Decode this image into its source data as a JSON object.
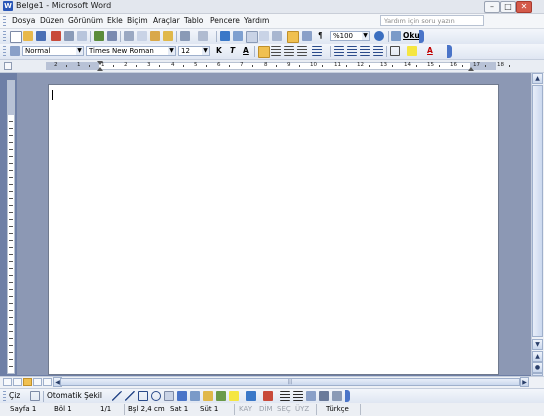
{
  "window": {
    "title": "Belge1 - Microsoft Word",
    "app_icon": "W",
    "minimize": "–",
    "maximize": "□",
    "close": "✕"
  },
  "menu": {
    "items": [
      "Dosya",
      "Düzen",
      "Görünüm",
      "Ekle",
      "Biçim",
      "Araçlar",
      "Tablo",
      "Pencere",
      "Yardım"
    ],
    "help_placeholder": "Yardım için soru yazın"
  },
  "standard_toolbar": {
    "zoom": "%100",
    "read_label": "Oku",
    "pilcrow": "¶"
  },
  "formatting_toolbar": {
    "style": "Normal",
    "font": "Times New Roman",
    "size": "12",
    "bold": "K",
    "italic": "T",
    "underline": "A",
    "font_color": "A"
  },
  "ruler": {
    "numbers": [
      "2",
      "1",
      "1",
      "2",
      "3",
      "4",
      "5",
      "6",
      "7",
      "8",
      "9",
      "10",
      "11",
      "12",
      "13",
      "14",
      "15",
      "16",
      "17",
      "18"
    ]
  },
  "drawing_toolbar": {
    "draw_label": "Çiz",
    "autoshapes_label": "Otomatik Şekil"
  },
  "status_bar": {
    "page": "Sayfa 1",
    "section": "Böl 1",
    "pages": "1/1",
    "position": "Bşl 2,4 cm",
    "line": "Sat 1",
    "column": "Süt 1",
    "rec": "KAY",
    "trk": "DİM",
    "ext": "SEÇ",
    "ovr": "ÜYZ",
    "language": "Türkçe"
  },
  "colors": {
    "accent": "#4a74c8",
    "title_bar": "#e3e7ee",
    "doc_background": "#8c98b4",
    "close": "#d45a4a"
  }
}
